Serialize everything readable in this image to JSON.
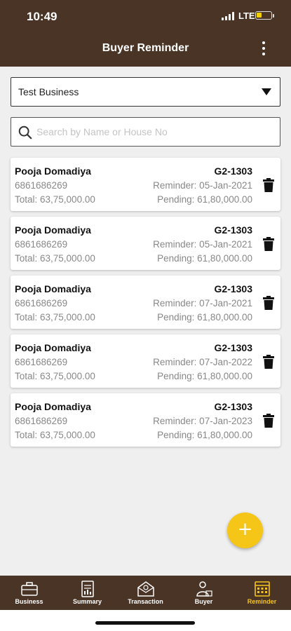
{
  "status_bar": {
    "time": "10:49",
    "network": "LTE"
  },
  "header": {
    "title": "Buyer Reminder"
  },
  "business_select": {
    "value": "Test Business"
  },
  "search": {
    "placeholder": "Search by Name or House No"
  },
  "reminders": [
    {
      "name": "Pooja Domadiya",
      "phone": "6861686269",
      "total": "Total: 63,75,000.00",
      "house": "G2-1303",
      "reminder": "Reminder: 05-Jan-2021",
      "pending": "Pending: 61,80,000.00"
    },
    {
      "name": "Pooja Domadiya",
      "phone": "6861686269",
      "total": "Total: 63,75,000.00",
      "house": "G2-1303",
      "reminder": "Reminder: 05-Jan-2021",
      "pending": "Pending: 61,80,000.00"
    },
    {
      "name": "Pooja Domadiya",
      "phone": "6861686269",
      "total": "Total: 63,75,000.00",
      "house": "G2-1303",
      "reminder": "Reminder: 07-Jan-2021",
      "pending": "Pending: 61,80,000.00"
    },
    {
      "name": "Pooja Domadiya",
      "phone": "6861686269",
      "total": "Total: 63,75,000.00",
      "house": "G2-1303",
      "reminder": "Reminder: 07-Jan-2022",
      "pending": "Pending: 61,80,000.00"
    },
    {
      "name": "Pooja Domadiya",
      "phone": "6861686269",
      "total": "Total: 63,75,000.00",
      "house": "G2-1303",
      "reminder": "Reminder: 07-Jan-2023",
      "pending": "Pending: 61,80,000.00"
    }
  ],
  "fab": {
    "label": "+"
  },
  "bottom_nav": {
    "items": [
      {
        "label": "Business",
        "icon": "briefcase-icon"
      },
      {
        "label": "Summary",
        "icon": "summary-icon"
      },
      {
        "label": "Transaction",
        "icon": "transaction-icon"
      },
      {
        "label": "Buyer",
        "icon": "buyer-icon"
      },
      {
        "label": "Reminder",
        "icon": "reminder-icon"
      }
    ],
    "active": "Reminder"
  },
  "colors": {
    "primary": "#4a3426",
    "accent": "#f5c518",
    "background": "#efefef"
  }
}
